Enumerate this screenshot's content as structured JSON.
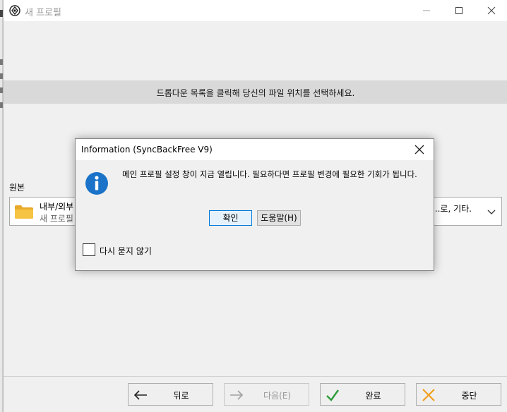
{
  "window": {
    "title": "새 프로필"
  },
  "banner": {
    "text": "드롭다운 목록을 클릭해 당신의 파일 위치를 선택하세요."
  },
  "source": {
    "label": "원본",
    "combo_main": "내부/외부",
    "combo_sub": "새 프로필",
    "combo_right": "...로, 기타."
  },
  "nav": {
    "back": "뒤로",
    "next": "다음(E)",
    "done": "완료",
    "cancel": "중단"
  },
  "dialog": {
    "title": "Information (SyncBackFree V9)",
    "message": "메인 프로필 설정 창이 지금 열립니다. 필요하다면 프로필 변경에 필요한 기회가 됩니다.",
    "ok": "확인",
    "help": "도움말(H)",
    "dont_ask": "다시 묻지 않기",
    "dont_ask_checked": false
  },
  "colors": {
    "info_blue": "#1a73c8",
    "folder_yellow": "#f6c343",
    "ok_green": "#2e9b3a",
    "cancel_orange": "#f0a020"
  }
}
